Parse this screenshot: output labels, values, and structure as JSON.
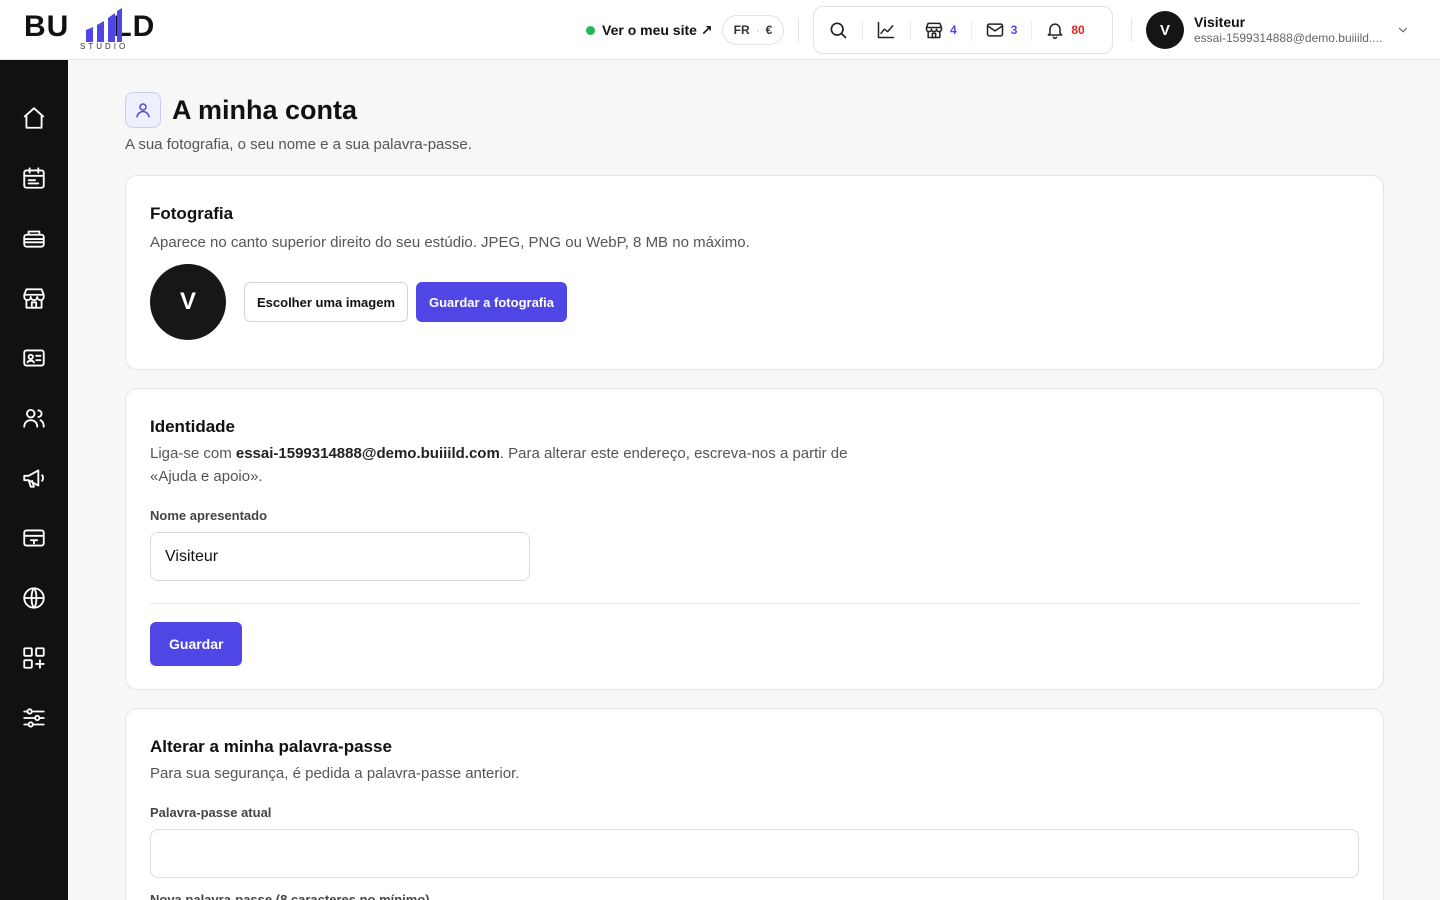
{
  "brand": {
    "logo_text": "BUIIILD",
    "logo_left": "BU",
    "logo_right": "LD",
    "logo_sub": "STUDIO"
  },
  "header": {
    "site_link": "Ver o meu site ↗",
    "lang": "FR",
    "currency": "€",
    "tools": {
      "search_icon": "search-icon",
      "stats_icon": "chart-line-icon",
      "store_count": "4",
      "mail_count": "3",
      "notif_count": "80"
    },
    "user": {
      "initial": "V",
      "name": "Visiteur",
      "email": "essai-1599314888@demo.buiiild...."
    }
  },
  "sidebar": {
    "items": [
      "home-icon",
      "calendar-icon",
      "services-icon",
      "store-icon",
      "contact-card-icon",
      "users-icon",
      "megaphone-icon",
      "payment-icon",
      "globe-icon",
      "apps-icon",
      "settings-sliders-icon"
    ]
  },
  "page": {
    "title": "A minha conta",
    "subtitle": "A sua fotografia, o seu nome e a sua palavra-passe."
  },
  "photo_card": {
    "title": "Fotografia",
    "desc": "Aparece no canto superior direito do seu estúdio. JPEG, PNG ou WebP, 8 MB no máximo.",
    "initial": "V",
    "choose_label": "Escolher uma imagem",
    "save_label": "Guardar a fotografia"
  },
  "identity_card": {
    "title": "Identidade",
    "desc_before": "Liga-se com ",
    "desc_email": "essai-1599314888@demo.buiiild.com",
    "desc_after": ". Para alterar este endereço, escreva-nos a partir de «Ajuda e apoio».",
    "name_label": "Nome apresentado",
    "name_value": "Visiteur",
    "save_label": "Guardar"
  },
  "password_card": {
    "title": "Alterar a minha palavra-passe",
    "desc": "Para sua segurança, é pedida a palavra-passe anterior.",
    "current_label": "Palavra-passe atual",
    "current_value": "",
    "new_label": "Nova palavra-passe (8 caracteres no mínimo)"
  },
  "colors": {
    "accent": "#4f46e5",
    "sidebar": "#111113",
    "online": "#1fb954",
    "alert": "#dc2626"
  }
}
